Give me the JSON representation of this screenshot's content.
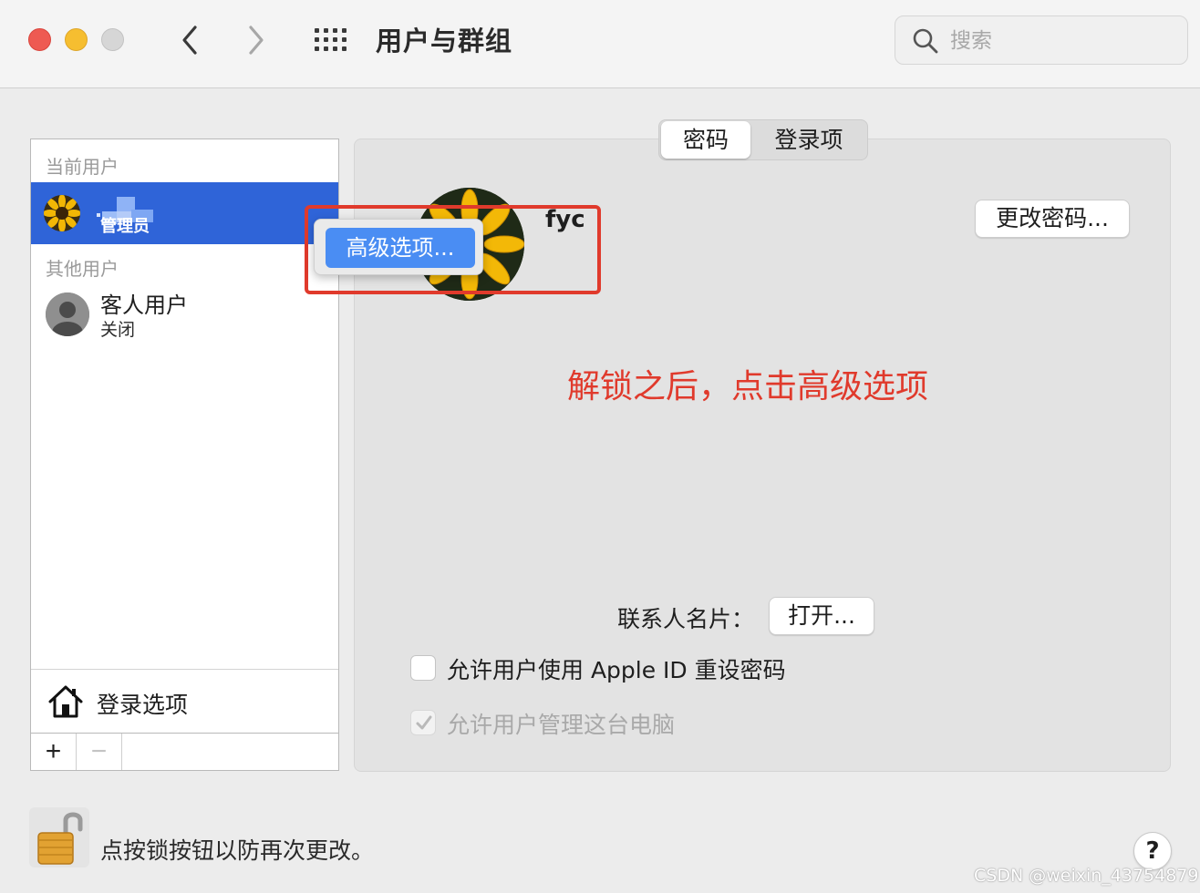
{
  "window": {
    "title": "用户与群组",
    "search_placeholder": "搜索"
  },
  "sidebar": {
    "current_users_label": "当前用户",
    "current_user": {
      "role": "管理员"
    },
    "other_users_label": "其他用户",
    "guest": {
      "name": "客人用户",
      "status": "关闭"
    },
    "login_options_label": "登录选项",
    "add_label": "+",
    "remove_label": "−"
  },
  "tabs": [
    {
      "label": "密码",
      "active": true
    },
    {
      "label": "登录项",
      "active": false
    }
  ],
  "detail": {
    "username": "fyc",
    "change_password_label": "更改密码...",
    "advanced_options_label": "高级选项...",
    "annotation": "解锁之后，点击高级选项",
    "contact_card_label": "联系人名片：",
    "open_label": "打开...",
    "checkbox_apple_id": {
      "label": "允许用户使用 Apple ID 重设密码",
      "checked": false,
      "enabled": true
    },
    "checkbox_admin": {
      "label": "允许用户管理这台电脑",
      "checked": true,
      "enabled": false
    }
  },
  "footer": {
    "lock_text": "点按锁按钮以防再次更改。",
    "help_label": "?",
    "watermark": "CSDN @weixin_43754879"
  },
  "colors": {
    "selection_blue": "#2f64d8",
    "accent_button": "#4a8df3",
    "annotation_red": "#e03a2c"
  },
  "icons": [
    "back-chevron-icon",
    "forward-chevron-icon",
    "show-all-grid-icon",
    "search-icon",
    "house-icon",
    "lock-open-icon",
    "checkmark-icon"
  ]
}
